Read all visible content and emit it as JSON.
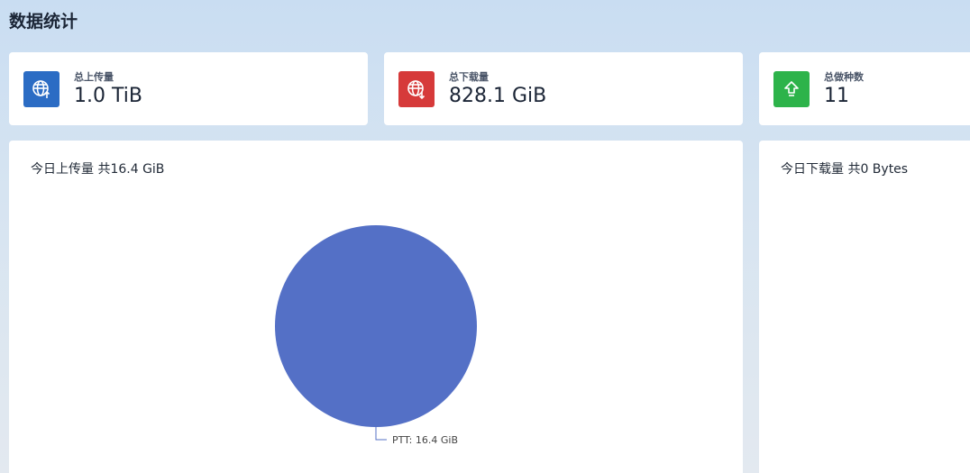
{
  "page": {
    "title": "数据统计"
  },
  "stats": [
    {
      "label": "总上传量",
      "value": "1.0 TiB",
      "icon": "globe-upload-icon",
      "color": "#2b6cc4"
    },
    {
      "label": "总下载量",
      "value": "828.1 GiB",
      "icon": "globe-download-icon",
      "color": "#d63a3a"
    },
    {
      "label": "总做种数",
      "value": "11",
      "icon": "upload-arrow-icon",
      "color": "#2db34a"
    }
  ],
  "upload_panel": {
    "title": "今日上传量 共16.4 GiB",
    "chart_data": {
      "type": "pie",
      "slices": [
        {
          "name": "PTT",
          "value": 16.4,
          "unit": "GiB",
          "label": "PTT: 16.4 GiB",
          "color": "#5470c6"
        }
      ]
    }
  },
  "download_panel": {
    "title": "今日下载量 共0 Bytes"
  }
}
